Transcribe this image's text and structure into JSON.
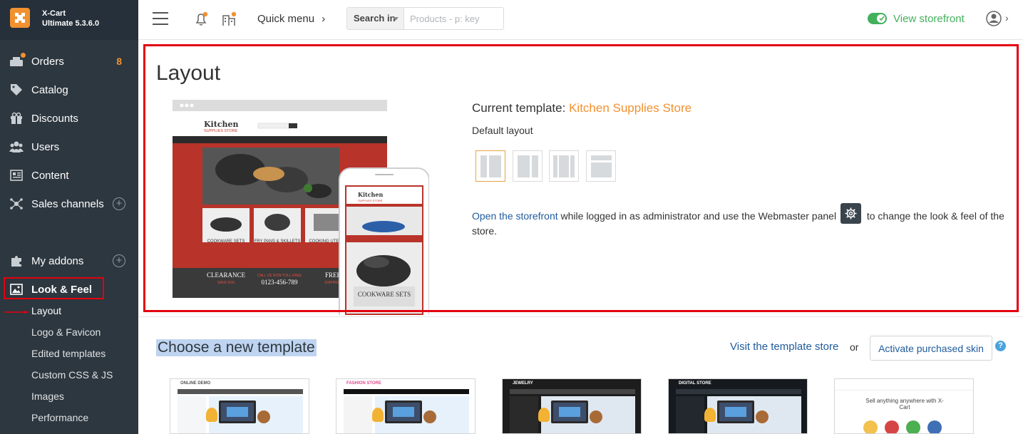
{
  "app": {
    "brand_line1": "X-Cart",
    "brand_line2": "Ultimate 5.3.6.0"
  },
  "sidebar": {
    "items": [
      {
        "label": "Orders",
        "icon": "orders-icon",
        "count": "8"
      },
      {
        "label": "Catalog",
        "icon": "tag-icon"
      },
      {
        "label": "Discounts",
        "icon": "gift-icon"
      },
      {
        "label": "Users",
        "icon": "users-icon"
      },
      {
        "label": "Content",
        "icon": "content-icon"
      },
      {
        "label": "Sales channels",
        "icon": "network-icon"
      },
      {
        "label": "My addons",
        "icon": "puzzle-icon"
      },
      {
        "label": "Look & Feel",
        "icon": "image-icon"
      }
    ],
    "sub_items": [
      "Layout",
      "Logo & Favicon",
      "Edited templates",
      "Custom CSS & JS",
      "Images",
      "Performance"
    ],
    "active_sub": "Layout"
  },
  "topbar": {
    "quick_menu": "Quick menu",
    "search_in": "Search in",
    "search_placeholder": "Products - p: key",
    "view_storefront": "View storefront"
  },
  "layout": {
    "title": "Layout",
    "current_template_label": "Current template:",
    "current_template_name": "Kitchen Supplies Store",
    "default_layout": "Default layout",
    "storefront_link": "Open the storefront",
    "storefront_text_1": "while logged in as administrator and use the Webmaster panel",
    "storefront_text_2": "to change the look & feel of the store.",
    "layout_options": [
      "left-sidebar",
      "right-sidebar",
      "three-columns",
      "one-column"
    ],
    "selected_layout": "left-sidebar"
  },
  "preview": {
    "desktop_title": "Kitchen",
    "desktop_subtitle": "SUPPLIES STORE",
    "products": [
      "COOKWARE SETS",
      "FRY PANS & SKILLETS",
      "COOKING UTENSIL"
    ],
    "clearance": "CLEARANCE",
    "clearance_sub": "SAVE 50%",
    "call_label": "CALL US NOW TOLL FREE",
    "phone": "0123-456-789",
    "free_label": "FREE",
    "free_sub": "SHIPPING",
    "mobile_title": "Kitchen",
    "mobile_subtitle": "SUPPLIES STORE",
    "mobile_product": "COOKWARE SETS"
  },
  "templates": {
    "title": "Choose a new template",
    "visit_store": "Visit the template store",
    "or": "or",
    "activate": "Activate purchased skin",
    "help": "?",
    "items": [
      {
        "name": "ONLINE DEMO"
      },
      {
        "name": "FASHION STORE"
      },
      {
        "name": "JEWELRY"
      },
      {
        "name": "DIGITAL STORE"
      },
      {
        "name": "Sell anything anywhere with X-Cart"
      }
    ]
  }
}
